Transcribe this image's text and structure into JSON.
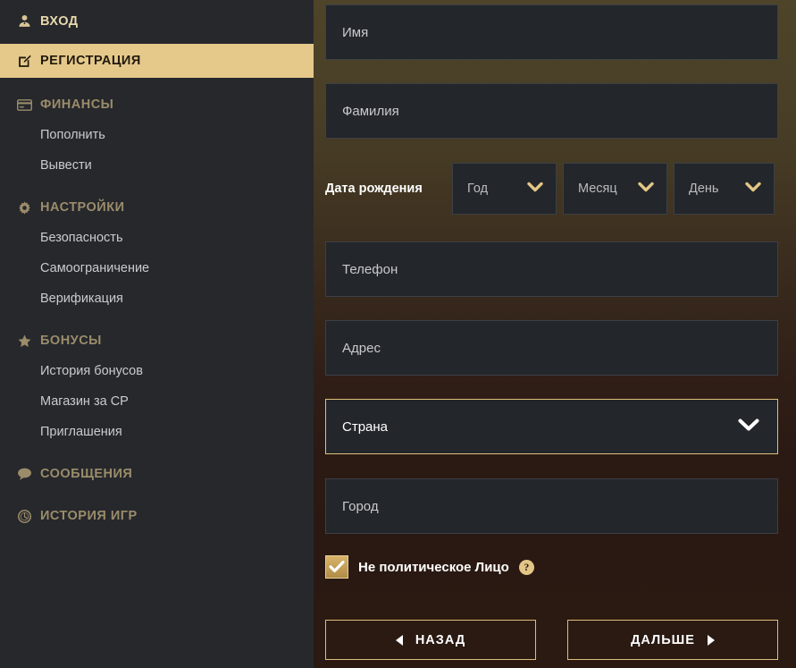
{
  "sidebar": {
    "items": [
      {
        "label": "ВХОД",
        "icon": "user-icon",
        "type": "top"
      },
      {
        "label": "РЕГИСТРАЦИЯ",
        "icon": "edit-icon",
        "type": "active"
      },
      {
        "label": "ФИНАНСЫ",
        "icon": "card-icon",
        "type": "section"
      },
      {
        "label": "Пополнить",
        "icon": "",
        "type": "sub"
      },
      {
        "label": "Вывести",
        "icon": "",
        "type": "sub"
      },
      {
        "label": "НАСТРОЙКИ",
        "icon": "gear-icon",
        "type": "section"
      },
      {
        "label": "Безопасность",
        "icon": "",
        "type": "sub"
      },
      {
        "label": "Самоограничение",
        "icon": "",
        "type": "sub"
      },
      {
        "label": "Верификация",
        "icon": "",
        "type": "sub"
      },
      {
        "label": "БОНУСЫ",
        "icon": "star-icon",
        "type": "section"
      },
      {
        "label": "История бонусов",
        "icon": "",
        "type": "sub"
      },
      {
        "label": "Магазин за CP",
        "icon": "",
        "type": "sub"
      },
      {
        "label": "Приглашения",
        "icon": "",
        "type": "sub"
      },
      {
        "label": "СООБЩЕНИЯ",
        "icon": "chat-icon",
        "type": "section"
      },
      {
        "label": "ИСТОРИЯ ИГР",
        "icon": "clock-icon",
        "type": "section"
      }
    ]
  },
  "form": {
    "first_name_placeholder": "Имя",
    "last_name_placeholder": "Фамилия",
    "dob_label": "Дата рождения",
    "dob_year_placeholder": "Год",
    "dob_month_placeholder": "Месяц",
    "dob_day_placeholder": "День",
    "phone_placeholder": "Телефон",
    "address_placeholder": "Адрес",
    "country_placeholder": "Страна",
    "city_placeholder": "Город",
    "pep_checkbox_label": "Не политическое Лицо",
    "help_glyph": "?",
    "back_button": "НАЗАД",
    "next_button": "ДАЛЬШЕ"
  },
  "colors": {
    "accent_gold": "#e5c98b",
    "sidebar_bg": "#26282c",
    "field_bg": "#23262a",
    "highlight_border": "#e0c07a"
  }
}
